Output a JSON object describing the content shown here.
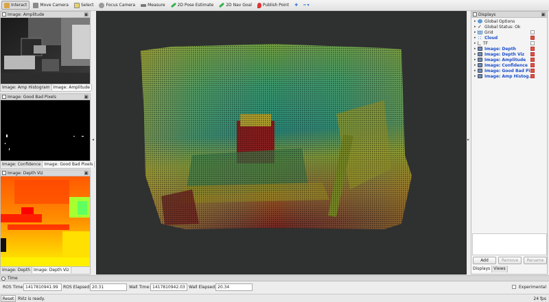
{
  "toolbar": {
    "tools": [
      {
        "label": "Interact",
        "icon": "interact-icon",
        "color": "#d9a54a",
        "active": true
      },
      {
        "label": "Move Camera",
        "icon": "move-camera-icon",
        "color": "#8a8a8a"
      },
      {
        "label": "Select",
        "icon": "select-icon",
        "color": "#e6d36c"
      },
      {
        "label": "Focus Camera",
        "icon": "focus-camera-icon",
        "color": "#9a9a9a"
      },
      {
        "label": "Measure",
        "icon": "measure-icon",
        "color": "#777"
      },
      {
        "label": "2D Pose Estimate",
        "icon": "pose-estimate-icon",
        "color": "#34b14a"
      },
      {
        "label": "2D Nav Goal",
        "icon": "nav-goal-icon",
        "color": "#34b14a"
      },
      {
        "label": "Publish Point",
        "icon": "publish-point-icon",
        "color": "#d33"
      }
    ],
    "plus_label": "✚",
    "more_label": "━ ▾"
  },
  "panels": [
    {
      "title": "Image: Amplitude",
      "tabs": [
        "Image: Amp Histogram",
        "Image: Amplitude"
      ],
      "selected": 1
    },
    {
      "title": "Image: Good Bad Pixels",
      "tabs": [
        "Image: Confidence",
        "Image: Good Bad Pixels"
      ],
      "selected": 1
    },
    {
      "title": "Image: Depth Viz",
      "tabs": [
        "Image: Depth",
        "Image: Depth Viz"
      ],
      "selected": 1
    }
  ],
  "displays": {
    "title": "Displays",
    "items": [
      {
        "label": "Global Options",
        "icon": "global-options-icon",
        "color": "#5b9bd5",
        "blue": false,
        "check": null
      },
      {
        "label": "Global Status: Ok",
        "icon": "status-ok-icon",
        "color": "#2a2a2a",
        "blue": false,
        "check": null
      },
      {
        "label": "Grid",
        "icon": "grid-icon",
        "color": "#3f7fbf",
        "blue": false,
        "check": false
      },
      {
        "label": "Cloud",
        "icon": "cloud-icon",
        "color": "#5b9bd5",
        "blue": true,
        "check": true
      },
      {
        "label": "TF",
        "icon": "tf-icon",
        "color": "#888",
        "blue": false,
        "check": false
      },
      {
        "label": "Image: Depth",
        "icon": "image-icon",
        "color": "#6c8fb8",
        "blue": true,
        "check": true
      },
      {
        "label": "Image: Depth Viz",
        "icon": "image-icon",
        "color": "#6c8fb8",
        "blue": true,
        "check": true
      },
      {
        "label": "Image: Amplitude",
        "icon": "image-icon",
        "color": "#6c8fb8",
        "blue": true,
        "check": true
      },
      {
        "label": "Image: Confidence",
        "icon": "image-icon",
        "color": "#6c8fb8",
        "blue": true,
        "check": true
      },
      {
        "label": "Image: Good Bad Pi...",
        "icon": "image-icon",
        "color": "#6c8fb8",
        "blue": true,
        "check": true
      },
      {
        "label": "Image: Amp Histog...",
        "icon": "image-icon",
        "color": "#6c8fb8",
        "blue": true,
        "check": true
      }
    ],
    "buttons": {
      "add": "Add",
      "remove": "Remove",
      "rename": "Rename"
    },
    "tabs": [
      "Displays",
      "Views"
    ]
  },
  "time": {
    "title": "Time",
    "ros_time_label": "ROS Time:",
    "ros_time": "1417810941.99",
    "ros_elapsed_label": "ROS Elapsed:",
    "ros_elapsed": "20.31",
    "wall_time_label": "Wall Time:",
    "wall_time": "1417810942.03",
    "wall_elapsed_label": "Wall Elapsed:",
    "wall_elapsed": "20.34",
    "experimental_label": "Experimental"
  },
  "status": {
    "reset_label": "Reset",
    "message": "RViz is ready.",
    "fps": "24 fps"
  },
  "colors": {
    "viewport_bg": "#2f3030",
    "check_on": "#e0553b",
    "blue_text": "#1a4fc9"
  }
}
